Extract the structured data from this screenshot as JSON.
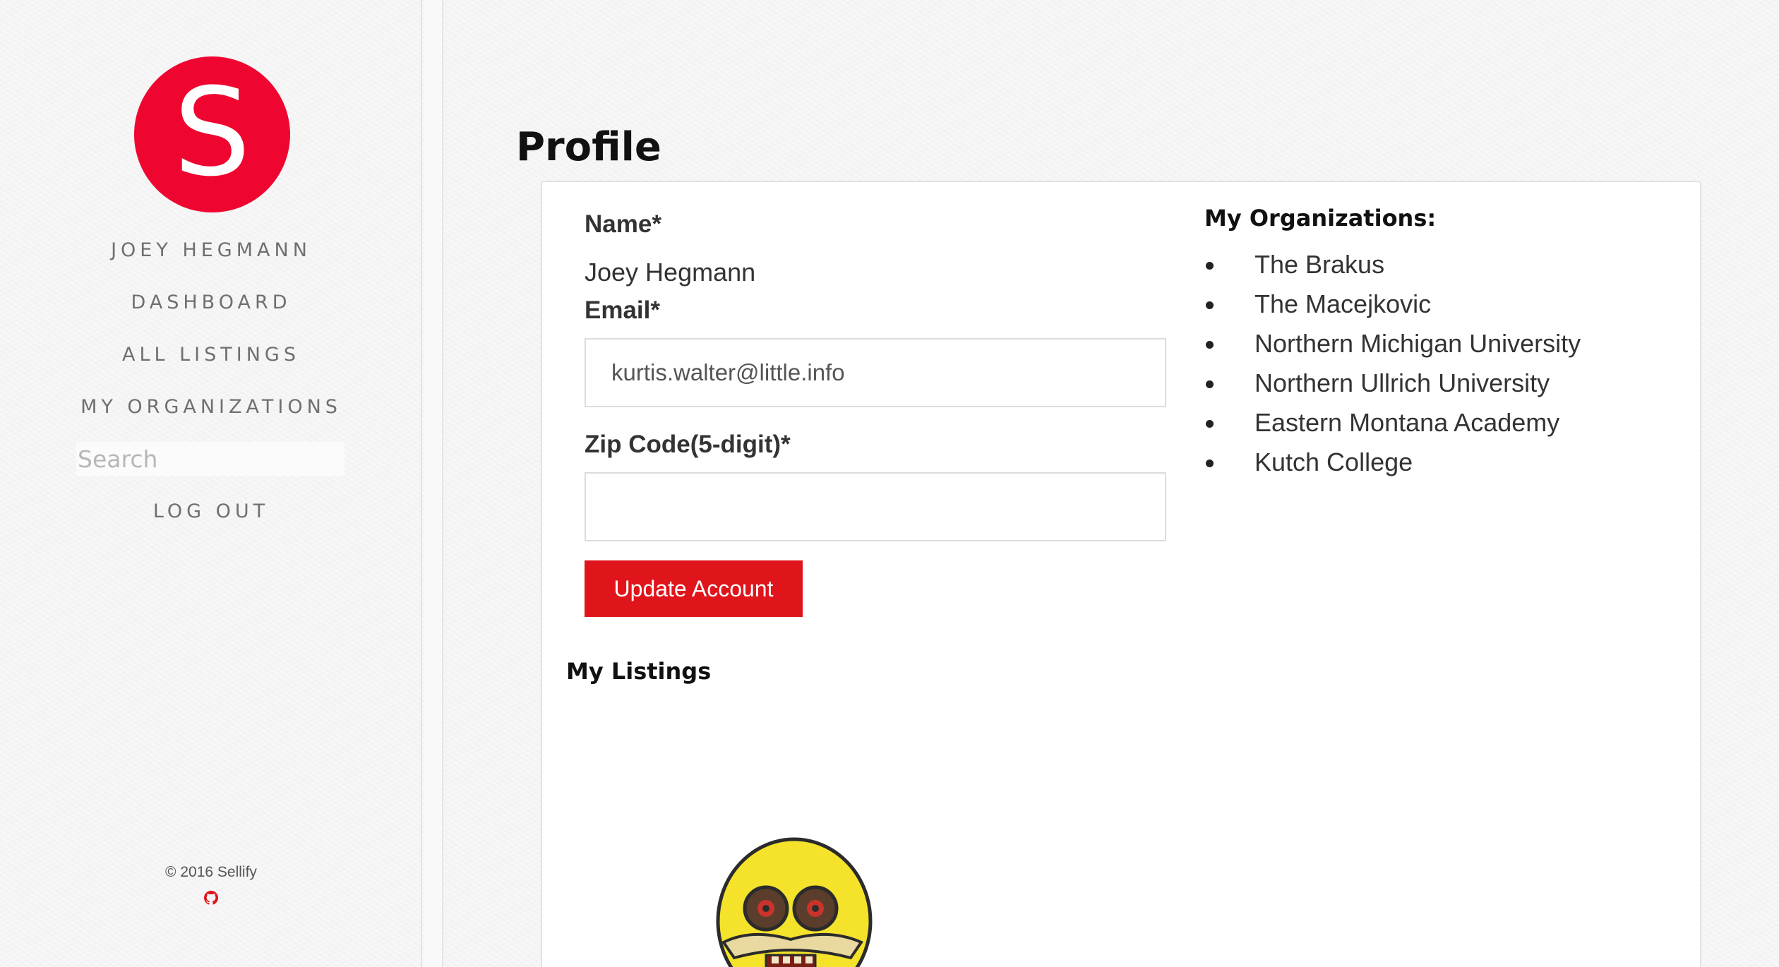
{
  "sidebar": {
    "logo_letter": "S",
    "nav": {
      "user_name": "JOEY HEGMANN",
      "dashboard": "DASHBOARD",
      "all_listings": "ALL LISTINGS",
      "my_organizations": "MY ORGANIZATIONS",
      "log_out": "LOG OUT"
    },
    "search_placeholder": "Search",
    "footer_copyright": "© 2016 Sellify",
    "footer_icon": "github-icon"
  },
  "main": {
    "title": "Profile",
    "form": {
      "name_label": "Name*",
      "name_value": "Joey Hegmann",
      "email_label": "Email*",
      "email_value": "kurtis.walter@little.info",
      "zip_label": "Zip Code(5-digit)*",
      "zip_value": "",
      "update_button": "Update Account"
    },
    "organizations": {
      "heading": "My Organizations:",
      "items": [
        "The Brakus",
        "The Macejkovic",
        "Northern Michigan University",
        "Northern Ullrich University",
        "Eastern Montana Academy",
        "Kutch College"
      ]
    },
    "listings": {
      "heading": "My Listings",
      "image_icon": "yellow-cartoon-face-image"
    }
  },
  "colors": {
    "brand_red": "#ef0630",
    "button_red": "#e0141b",
    "nav_text": "#6f6f6f"
  }
}
